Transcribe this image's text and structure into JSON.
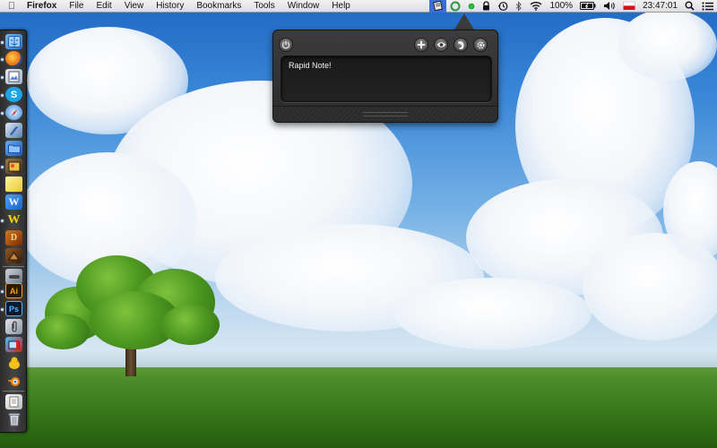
{
  "menubar": {
    "apple_icon": "apple-logo-icon",
    "app_name": "Firefox",
    "menus": [
      "File",
      "Edit",
      "View",
      "History",
      "Bookmarks",
      "Tools",
      "Window",
      "Help"
    ],
    "tray": {
      "battery_percent": "100%",
      "clock": "23:47:01",
      "icons": [
        "rapid-note-icon",
        "sync-icon",
        "status-dot-icon",
        "lock-icon",
        "time-machine-icon",
        "bluetooth-icon",
        "wifi-icon",
        "battery-icon",
        "volume-icon",
        "flag-icon",
        "spotlight-icon",
        "notification-list-icon"
      ]
    }
  },
  "dock": {
    "items": [
      "finder",
      "firefox",
      "preview",
      "skype",
      "safari",
      "xcode",
      "folder",
      "iphoto",
      "stickies",
      "word",
      "yahtzee",
      "diablo",
      "game",
      "steam",
      "illustrator",
      "photoshop",
      "paperclip",
      "photo-booth",
      "adium",
      "blender",
      "documents",
      "trash"
    ]
  },
  "popover": {
    "note_text": "Rapid Note!",
    "buttons": [
      "power",
      "add",
      "view",
      "evernote",
      "settings"
    ]
  },
  "colors": {
    "menubar": "#e6e6e6",
    "selected_tray": "#3a6fd8",
    "popover_bg": "#2f2f2f"
  }
}
